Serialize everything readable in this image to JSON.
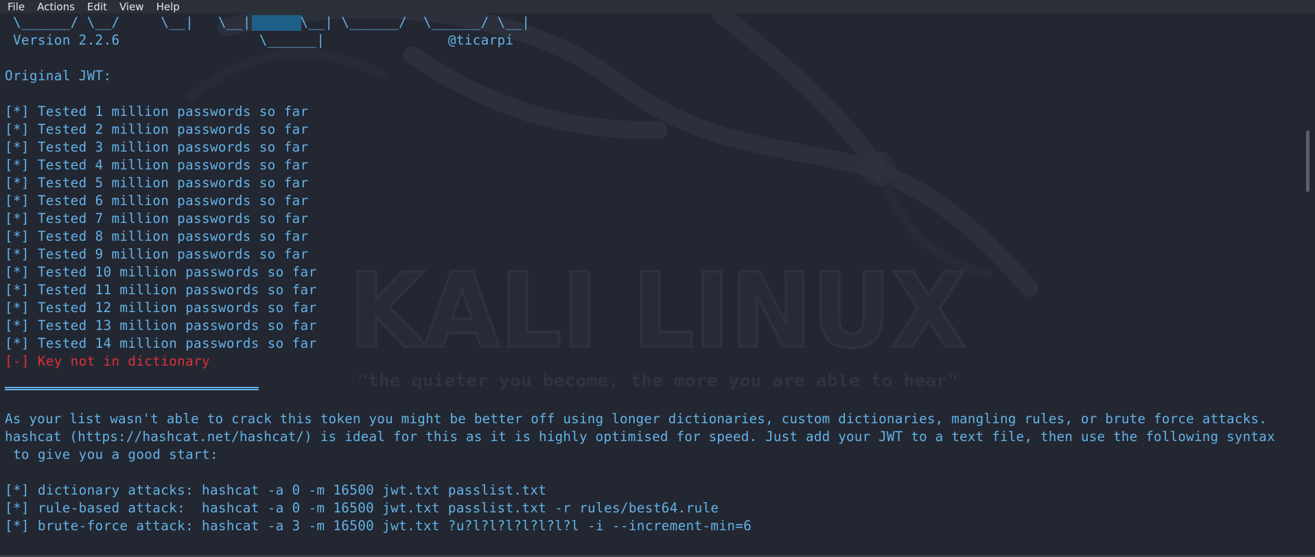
{
  "menu": {
    "items": [
      "File",
      "Actions",
      "Edit",
      "View",
      "Help"
    ]
  },
  "watermark": {
    "title": "KALI LINUX",
    "tagline": "\"the quieter you become, the more you are able to hear\""
  },
  "banner": {
    "art_line": " \\______/ \\__/     \\__|   \\__|      \\__| \\______/  \\______/ \\__|",
    "version_line": " Version 2.2.6                 \\______|               @ticarpi"
  },
  "original_jwt_label": "Original JWT:",
  "progress_lines": [
    "[*] Tested 1 million passwords so far",
    "[*] Tested 2 million passwords so far",
    "[*] Tested 3 million passwords so far",
    "[*] Tested 4 million passwords so far",
    "[*] Tested 5 million passwords so far",
    "[*] Tested 6 million passwords so far",
    "[*] Tested 7 million passwords so far",
    "[*] Tested 8 million passwords so far",
    "[*] Tested 9 million passwords so far",
    "[*] Tested 10 million passwords so far",
    "[*] Tested 11 million passwords so far",
    "[*] Tested 12 million passwords so far",
    "[*] Tested 13 million passwords so far",
    "[*] Tested 14 million passwords so far"
  ],
  "result_line": "[-] Key not in dictionary",
  "advice_lines": [
    "As your list wasn't able to crack this token you might be better off using longer dictionaries, custom dictionaries, mangling rules, or brute force attacks.",
    "hashcat (https://hashcat.net/hashcat/) is ideal for this as it is highly optimised for speed. Just add your JWT to a text file, then use the following syntax",
    " to give you a good start:"
  ],
  "command_lines": [
    "[*] dictionary attacks: hashcat -a 0 -m 16500 jwt.txt passlist.txt",
    "[*] rule-based attack:  hashcat -a 0 -m 16500 jwt.txt passlist.txt -r rules/best64.rule",
    "[*] brute-force attack: hashcat -a 3 -m 16500 jwt.txt ?u?l?l?l?l?l?l?l -i --increment-min=6"
  ],
  "colors": {
    "background": "#232731",
    "text": "#63b3e8",
    "error": "#e0303a",
    "selection": "#1e5f88"
  }
}
